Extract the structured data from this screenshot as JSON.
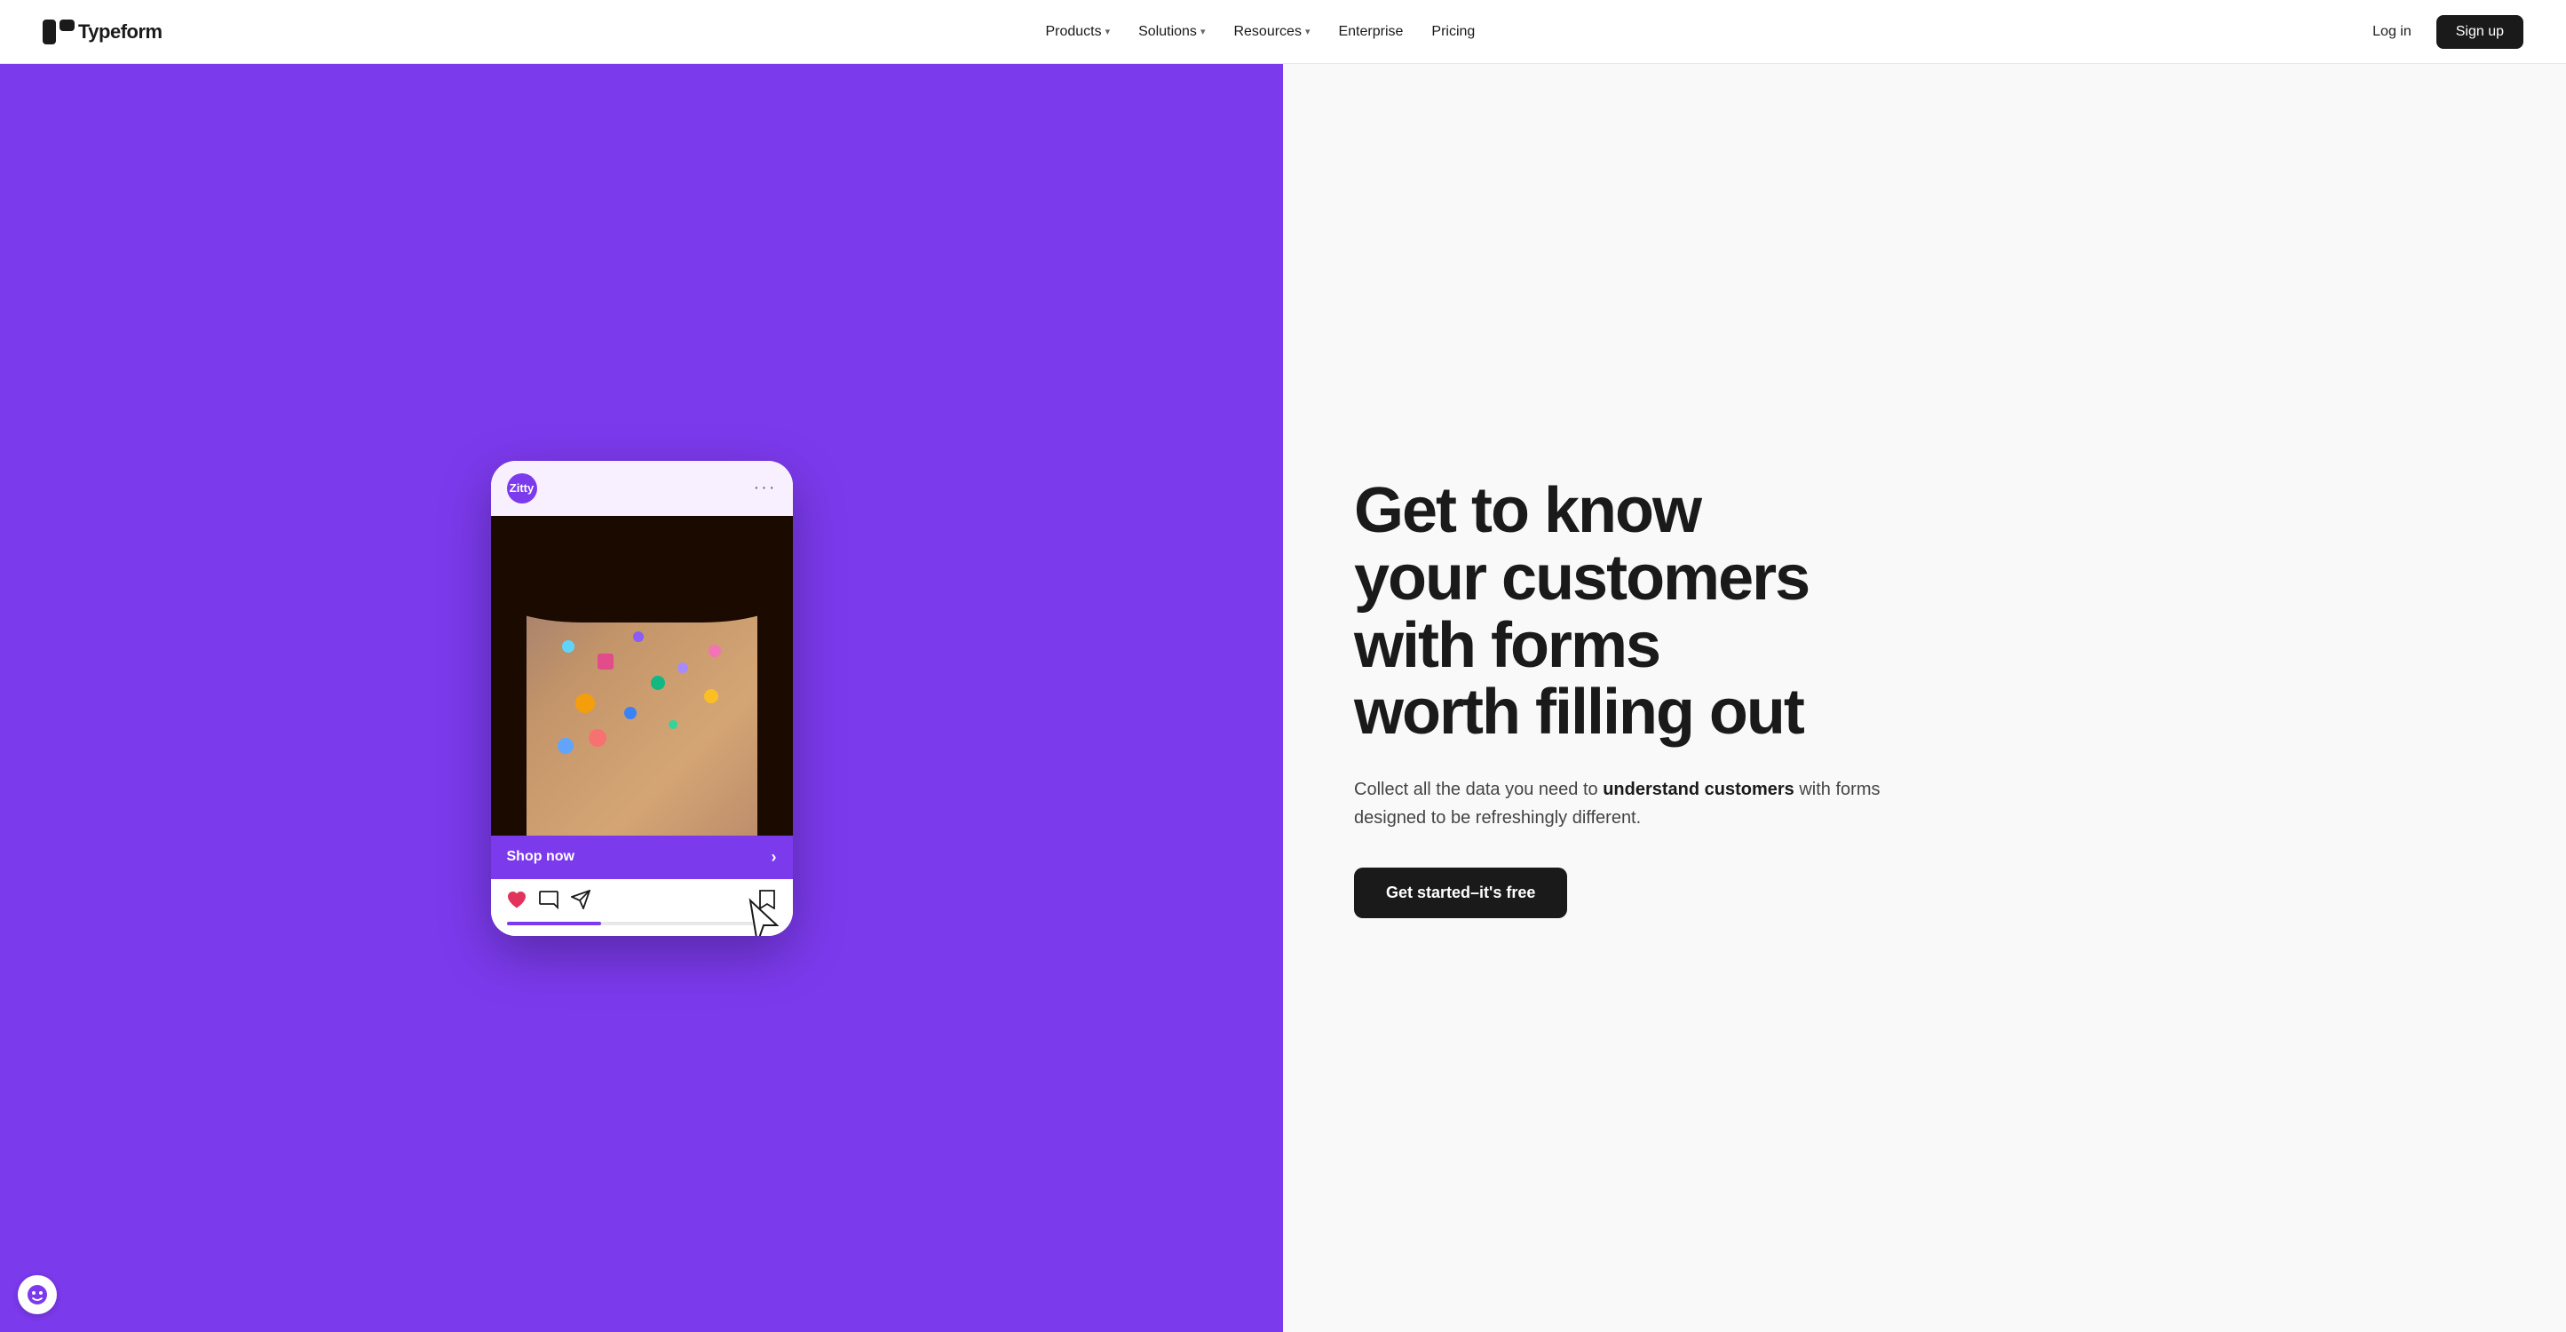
{
  "brand": {
    "name": "Typeform",
    "logo_icon": "■ ■"
  },
  "navbar": {
    "products_label": "Products",
    "solutions_label": "Solutions",
    "resources_label": "Resources",
    "enterprise_label": "Enterprise",
    "pricing_label": "Pricing",
    "login_label": "Log in",
    "signup_label": "Sign up"
  },
  "hero": {
    "phone": {
      "brand_name": "Zitty",
      "shop_now_label": "Shop now",
      "arrow": "›"
    },
    "headline_line1": "Get to know",
    "headline_line2": "your customers",
    "headline_line3": "with forms",
    "headline_line4": "worth filling out",
    "subtext_prefix": "Collect all the data you need to ",
    "subtext_bold": "understand customers",
    "subtext_suffix": " with forms designed to be refreshingly different.",
    "cta_label": "Get started–it's free"
  },
  "colors": {
    "purple": "#7c3aed",
    "dark": "#1a1a1a",
    "white": "#ffffff"
  }
}
